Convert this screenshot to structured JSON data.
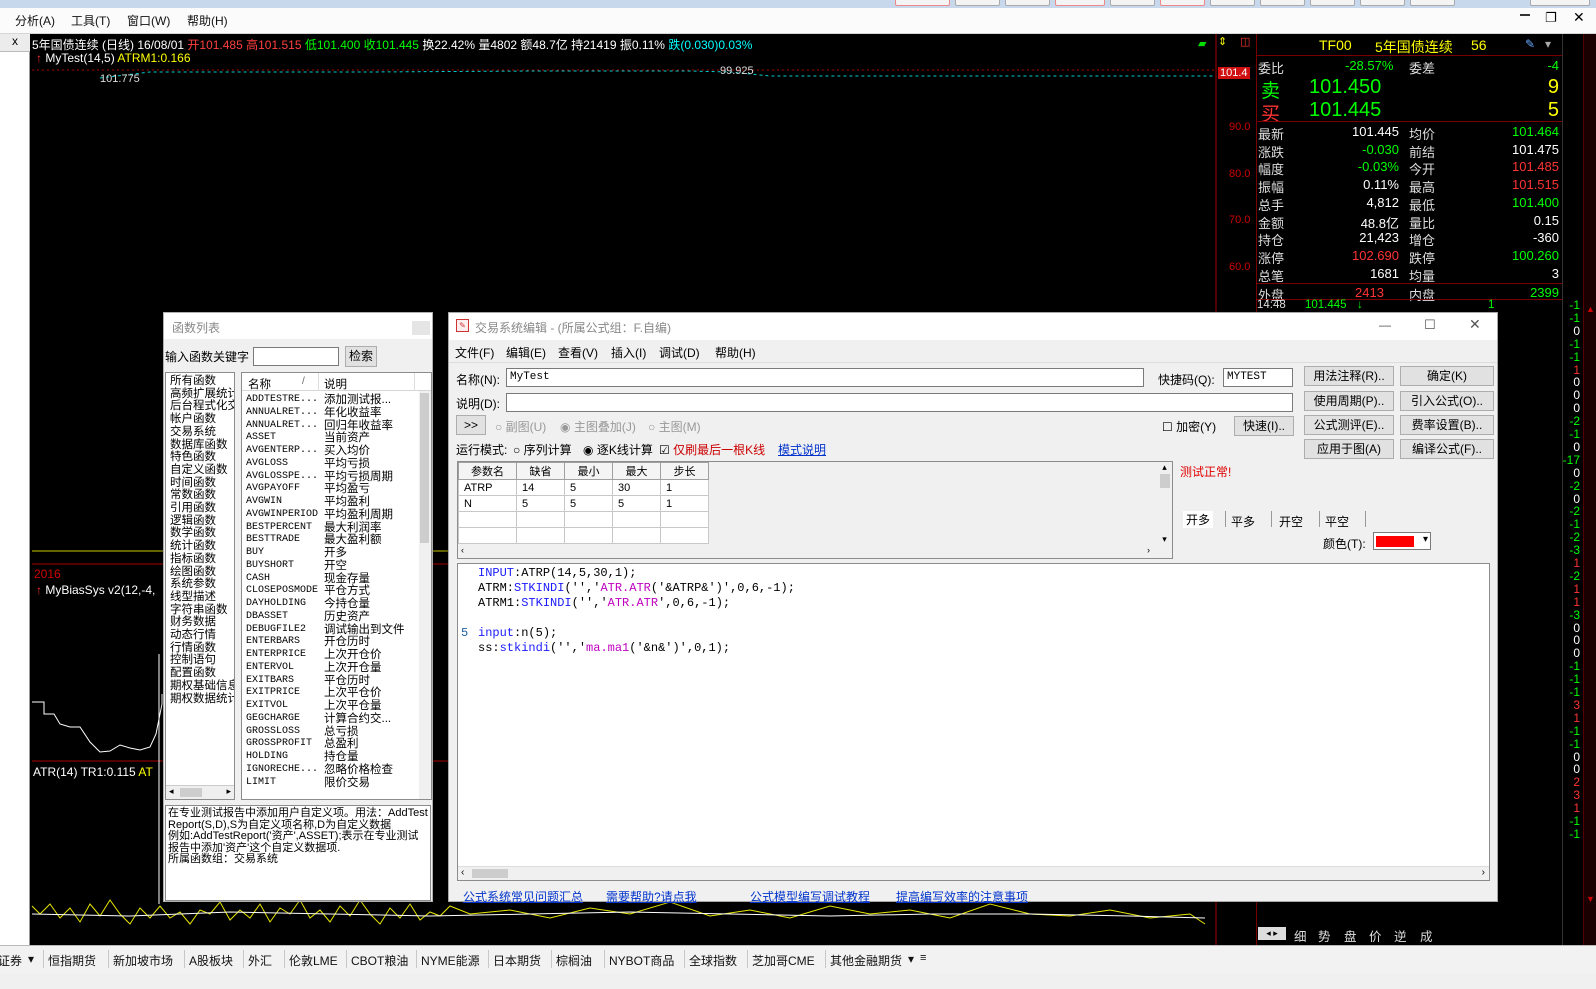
{
  "menubar": {
    "items": [
      "分析(A)",
      "工具(T)",
      "窗口(W)",
      "帮助(H)"
    ]
  },
  "chart": {
    "header": {
      "title": "5年国债连续 (日线) 16/08/01",
      "open": "开101.485",
      "high": "高101.515",
      "low": "低101.400",
      "close": "收101.445",
      "turnover": "换22.42%",
      "volume": "量4802",
      "amount": "额48.7亿",
      "position": "持21419",
      "amplitude": "振0.11%",
      "change": "跌(0.030)0.03%"
    },
    "indicator1": "MyTest(14,5)",
    "indicator1_value": "ATRM1:0.166",
    "price_labels": [
      "101.775",
      "99.925"
    ],
    "right_tag": "101.4",
    "y_ticks": [
      "90.0",
      "80.0",
      "70.0",
      "60.0"
    ],
    "year_label": "2016",
    "indicator2": "MyBiasSys v2(12,-4,",
    "indicator3": "ATR(14)",
    "indicator3_value": "TR1:0.115",
    "indicator3_extra": "AT"
  },
  "left_pane": {
    "close": "x"
  },
  "quote": {
    "code": "TF00",
    "name": "5年国债连续",
    "num": "56",
    "weibi_label": "委比",
    "weibi_value": "-28.57%",
    "weicha_label": "委差",
    "weicha_value": "-4",
    "sell_label": "卖",
    "sell_price": "101.450",
    "sell_vol": "9",
    "buy_label": "买",
    "buy_price": "101.445",
    "buy_vol": "5",
    "rows": [
      {
        "l1": "最新",
        "v1": "101.445",
        "l2": "均价",
        "v2": "101.464",
        "c1": "#ffffff",
        "c2": "#00ff00"
      },
      {
        "l1": "涨跌",
        "v1": "-0.030",
        "l2": "前结",
        "v2": "101.475",
        "c1": "#00ff00",
        "c2": "#ffffff"
      },
      {
        "l1": "幅度",
        "v1": "-0.03%",
        "l2": "今开",
        "v2": "101.485",
        "c1": "#00ff00",
        "c2": "#ff3333"
      },
      {
        "l1": "振幅",
        "v1": "0.11%",
        "l2": "最高",
        "v2": "101.515",
        "c1": "#ffffff",
        "c2": "#ff3333"
      },
      {
        "l1": "总手",
        "v1": "4,812",
        "l2": "最低",
        "v2": "101.400",
        "c1": "#ffffff",
        "c2": "#00ff00"
      },
      {
        "l1": "金额",
        "v1": "48.8亿",
        "l2": "量比",
        "v2": "0.15",
        "c1": "#ffffff",
        "c2": "#ffffff"
      },
      {
        "l1": "持仓",
        "v1": "21,423",
        "l2": "增仓",
        "v2": "-360",
        "c1": "#ffffff",
        "c2": "#ffffff"
      },
      {
        "l1": "涨停",
        "v1": "102.690",
        "l2": "跌停",
        "v2": "100.260",
        "c1": "#ff3333",
        "c2": "#00ff00"
      },
      {
        "l1": "总笔",
        "v1": "1681",
        "l2": "均量",
        "v2": "3",
        "c1": "#ffffff",
        "c2": "#ffffff"
      }
    ],
    "outer_label": "外盘",
    "outer_value": "2413",
    "inner_label": "内盘",
    "inner_value": "2399",
    "tick_time": "14:48",
    "tick_price": "101.445",
    "tick_arrow": "↓",
    "tick_vol": "1",
    "bottom_tabs": [
      "细",
      "势",
      "盘",
      "价",
      "逆",
      "成"
    ]
  },
  "right_column": [
    "-1",
    "-1",
    "0",
    "-1",
    "-1",
    "1",
    "0",
    "0",
    "0",
    "-2",
    "-1",
    "0",
    "-17",
    "0",
    "-2",
    "0",
    "-2",
    "-1",
    "-2",
    "-3",
    "1",
    "-2",
    "1",
    "1",
    "-3",
    "0",
    "0",
    "0",
    "-1",
    "-1",
    "-1",
    "3",
    "1",
    "-1",
    "-1",
    "0",
    "0",
    "2",
    "3",
    "1",
    "-1",
    "-1"
  ],
  "bottom_tabs": [
    "证券",
    "恒指期货",
    "新加坡市场",
    "A股板块",
    "外汇",
    "伦敦LME",
    "CBOT粮油",
    "NYME能源",
    "日本期货",
    "棕榈油",
    "NYBOT商品",
    "全球指数",
    "芝加哥CME",
    "其他金融期货"
  ],
  "function_list": {
    "title": "函数列表",
    "search_label": "输入函数关键字",
    "search_value": "",
    "search_button": "检索",
    "categories": [
      "所有函数",
      "高频扩展统计",
      "后台程式化交",
      "帐户函数",
      "交易系统",
      "数据库函数",
      "特色函数",
      "自定义函数",
      "时间函数",
      "常数函数",
      "引用函数",
      "逻辑函数",
      "数学函数",
      "统计函数",
      "指标函数",
      "绘图函数",
      "系统参数",
      "线型描述",
      "字符串函数",
      "财务数据",
      "动态行情",
      "行情函数",
      "控制语句",
      "配置函数",
      "期权基础信息",
      "期权数据统计"
    ],
    "col_name": "名称",
    "col_desc": "说明",
    "functions": [
      {
        "n": "ADDTESTRE...",
        "d": "添加测试报..."
      },
      {
        "n": "ANNUALRET...",
        "d": "年化收益率"
      },
      {
        "n": "ANNUALRET...",
        "d": "回归年收益率"
      },
      {
        "n": "ASSET",
        "d": "当前资产"
      },
      {
        "n": "AVGENTERP...",
        "d": "买入均价"
      },
      {
        "n": "AVGLOSS",
        "d": "平均亏损"
      },
      {
        "n": "AVGLOSSPE...",
        "d": "平均亏损周期"
      },
      {
        "n": "AVGPAYOFF",
        "d": "平均盈亏"
      },
      {
        "n": "AVGWIN",
        "d": "平均盈利"
      },
      {
        "n": "AVGWINPERIOD",
        "d": "平均盈利周期"
      },
      {
        "n": "BESTPERCENT",
        "d": "最大利润率"
      },
      {
        "n": "BESTTRADE",
        "d": "最大盈利额"
      },
      {
        "n": "BUY",
        "d": "开多"
      },
      {
        "n": "BUYSHORT",
        "d": "开空"
      },
      {
        "n": "CASH",
        "d": "现金存量"
      },
      {
        "n": "CLOSEPOSMODE",
        "d": "平仓方式"
      },
      {
        "n": "DAYHOLDING",
        "d": "今持仓量"
      },
      {
        "n": "DBASSET",
        "d": "历史资产"
      },
      {
        "n": "DEBUGFILE2",
        "d": "调试输出到文件"
      },
      {
        "n": "ENTERBARS",
        "d": "开仓历时"
      },
      {
        "n": "ENTERPRICE",
        "d": "上次开仓价"
      },
      {
        "n": "ENTERVOL",
        "d": "上次开仓量"
      },
      {
        "n": "EXITBARS",
        "d": "平仓历时"
      },
      {
        "n": "EXITPRICE",
        "d": "上次平仓价"
      },
      {
        "n": "EXITVOL",
        "d": "上次平仓量"
      },
      {
        "n": "GEGCHARGE",
        "d": "计算合约交..."
      },
      {
        "n": "GROSSLOSS",
        "d": "总亏损"
      },
      {
        "n": "GROSSPROFIT",
        "d": "总盈利"
      },
      {
        "n": "HOLDING",
        "d": "持仓量"
      },
      {
        "n": "IGNORECHE...",
        "d": "忽略价格检查"
      },
      {
        "n": "LIMIT",
        "d": "限价交易"
      }
    ],
    "help_text": "在专业测试报告中添加用户自定义项。用法：AddTestReport(S,D),S为自定义项名称,D为自定义数据\n例如:AddTestReport('资产',ASSET);表示在专业测试报告中添加'资产'这个自定义数据项.\n所属函数组：交易系统"
  },
  "editor": {
    "title": "交易系统编辑 - (所属公式组：F.自编)",
    "menu": [
      "文件(F)",
      "编辑(E)",
      "查看(V)",
      "插入(I)",
      "调试(D)",
      "帮助(H)"
    ],
    "name_label": "名称(N):",
    "name_value": "MyTest",
    "shortcut_label": "快捷码(Q):",
    "shortcut_value": "MYTEST",
    "desc_label": "说明(D):",
    "desc_value": "",
    "expand_btn": ">>",
    "radio_sub": "副图(U)",
    "radio_main_overlay": "主图叠加(J)",
    "radio_main": "主图(M)",
    "encrypt_label": "加密(Y)",
    "quick_btn": "快速(I)..",
    "mode_label": "运行模式:",
    "mode_serial": "序列计算",
    "mode_bar": "逐K线计算",
    "last_bar_only": "仅刷最后一根K线",
    "mode_help": "模式说明",
    "buttons": {
      "usage": "用法注释(R)..",
      "period": "使用周期(P)..",
      "evaluate": "公式测评(E)..",
      "apply": "应用于图(A)",
      "ok": "确定(K)",
      "import": "引入公式(O)..",
      "fee": "费率设置(B)..",
      "compile": "编译公式(F).."
    },
    "param_headers": [
      "参数名",
      "缺省",
      "最小",
      "最大",
      "步长"
    ],
    "params": [
      [
        "ATRP",
        "14",
        "5",
        "30",
        "1"
      ],
      [
        "N",
        "5",
        "5",
        "5",
        "1"
      ]
    ],
    "test_status": "测试正常!",
    "signal_tabs": [
      "开多",
      "平多",
      "开空",
      "平空"
    ],
    "color_label": "颜色(T):",
    "color_value": "#ff0000",
    "code_lines": [
      {
        "num": "",
        "segs": [
          {
            "t": "INPUT",
            "c": "blue"
          },
          {
            "t": ":ATRP(14,5,30,1);",
            "c": ""
          }
        ]
      },
      {
        "num": "",
        "segs": [
          {
            "t": "ATRM:",
            "c": ""
          },
          {
            "t": "STKINDI",
            "c": "blue"
          },
          {
            "t": "('','",
            "c": ""
          },
          {
            "t": "ATR.ATR",
            "c": "mag"
          },
          {
            "t": "('&ATRP&')',0,6,-1);",
            "c": ""
          }
        ]
      },
      {
        "num": "",
        "segs": [
          {
            "t": "ATRM1:",
            "c": ""
          },
          {
            "t": "STKINDI",
            "c": "blue"
          },
          {
            "t": "('','",
            "c": ""
          },
          {
            "t": "ATR.ATR",
            "c": "mag"
          },
          {
            "t": "',0,6,-1);",
            "c": ""
          }
        ]
      },
      {
        "num": "",
        "segs": []
      },
      {
        "num": "5",
        "segs": [
          {
            "t": "input",
            "c": "blue"
          },
          {
            "t": ":n(5);",
            "c": ""
          }
        ]
      },
      {
        "num": "",
        "segs": [
          {
            "t": "ss:",
            "c": ""
          },
          {
            "t": "stkindi",
            "c": "blue"
          },
          {
            "t": "('','",
            "c": ""
          },
          {
            "t": "ma.ma1",
            "c": "mag"
          },
          {
            "t": "('&n&')',0,1);",
            "c": ""
          }
        ]
      }
    ],
    "links": [
      "公式系统常见问题汇总",
      "需要帮助?请点我",
      "公式模型编写调试教程",
      "提高编写效率的注意事项"
    ]
  }
}
